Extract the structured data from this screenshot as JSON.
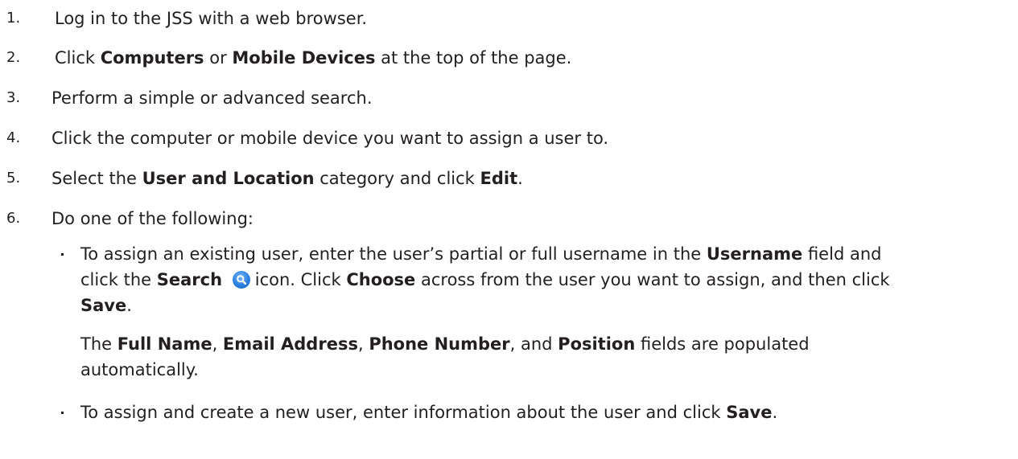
{
  "steps": [
    {
      "num": "1.",
      "parts": [
        {
          "t": "Log in to the JSS with a web browser.",
          "b": false
        }
      ]
    },
    {
      "num": "2.",
      "parts": [
        {
          "t": "Click ",
          "b": false
        },
        {
          "t": "Computers",
          "b": true
        },
        {
          "t": " or ",
          "b": false
        },
        {
          "t": "Mobile Devices",
          "b": true
        },
        {
          "t": " at the top of the page.",
          "b": false
        }
      ]
    },
    {
      "num": "3.",
      "parts": [
        {
          "t": "Perform a simple or advanced search.",
          "b": false
        }
      ]
    },
    {
      "num": "4.",
      "parts": [
        {
          "t": "Click the computer or mobile device you want to assign a user to.",
          "b": false
        }
      ]
    },
    {
      "num": "5.",
      "parts": [
        {
          "t": "Select the ",
          "b": false
        },
        {
          "t": "User and Location",
          "b": true
        },
        {
          "t": " category and click ",
          "b": false
        },
        {
          "t": "Edit",
          "b": true
        },
        {
          "t": ".",
          "b": false
        }
      ]
    },
    {
      "num": "6.",
      "parts": [
        {
          "t": "Do one of the following:",
          "b": false
        }
      ]
    }
  ],
  "bullet1": {
    "line1": [
      {
        "t": "To assign an existing user, enter the user’s partial or full username in the ",
        "b": false
      },
      {
        "t": "Username",
        "b": true
      },
      {
        "t": " field and",
        "b": false
      }
    ],
    "line2_before": [
      {
        "t": "click the ",
        "b": false
      },
      {
        "t": "Search",
        "b": true
      }
    ],
    "line2_after": [
      {
        "t": "icon. Click ",
        "b": false
      },
      {
        "t": "Choose",
        "b": true
      },
      {
        "t": " across from the user you want to assign, and then click",
        "b": false
      }
    ],
    "line3": [
      {
        "t": "Save",
        "b": true
      },
      {
        "t": ".",
        "b": false
      }
    ],
    "line4": [
      {
        "t": "The ",
        "b": false
      },
      {
        "t": "Full Name",
        "b": true
      },
      {
        "t": ", ",
        "b": false
      },
      {
        "t": "Email Address",
        "b": true
      },
      {
        "t": ", ",
        "b": false
      },
      {
        "t": "Phone Number",
        "b": true
      },
      {
        "t": ", and ",
        "b": false
      },
      {
        "t": "Position",
        "b": true
      },
      {
        "t": " fields are populated",
        "b": false
      }
    ],
    "line5": [
      {
        "t": "automatically.",
        "b": false
      }
    ]
  },
  "bullet2": {
    "line1": [
      {
        "t": "To assign and create a new user, enter information about the user and click ",
        "b": false
      },
      {
        "t": "Save",
        "b": true
      },
      {
        "t": ".",
        "b": false
      }
    ]
  },
  "icons": {
    "search": "search-icon"
  }
}
